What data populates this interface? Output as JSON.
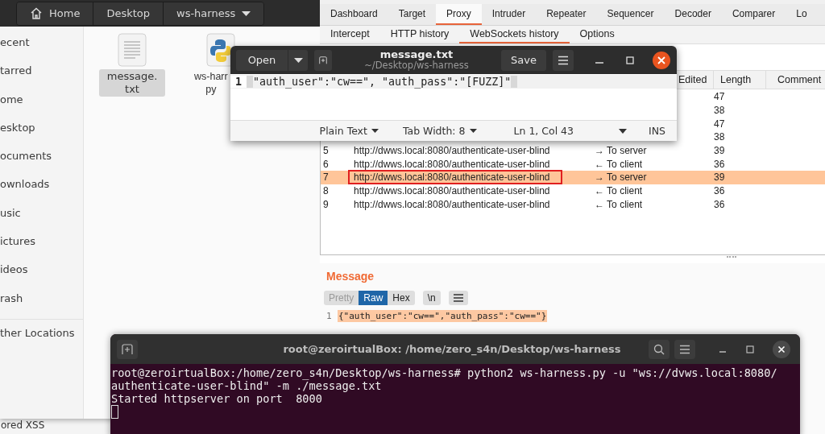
{
  "background_window": {
    "text": "ored XSS"
  },
  "file_manager": {
    "path": [
      {
        "label": "Home",
        "kind": "home"
      },
      {
        "label": "Desktop",
        "kind": "plain"
      },
      {
        "label": "ws-harness",
        "kind": "dropdown"
      }
    ],
    "sidebar": [
      "ecent",
      "tarred",
      "ome",
      "esktop",
      "ocuments",
      "ownloads",
      "usic",
      "ictures",
      "ideos",
      "rash"
    ],
    "sidebar_other": "ther Locations",
    "files": [
      {
        "kind": "text",
        "lines": [
          "message.",
          "txt"
        ],
        "selected": true
      },
      {
        "kind": "python",
        "lines": [
          "ws-harr",
          "py"
        ],
        "selected": false
      }
    ]
  },
  "burp": {
    "tabs": [
      {
        "label": "Dashboard",
        "selected": false
      },
      {
        "label": "Target",
        "selected": false
      },
      {
        "label": "Proxy",
        "selected": true
      },
      {
        "label": "Intruder",
        "selected": false
      },
      {
        "label": "Repeater",
        "selected": false
      },
      {
        "label": "Sequencer",
        "selected": false
      },
      {
        "label": "Decoder",
        "selected": false
      },
      {
        "label": "Comparer",
        "selected": false
      },
      {
        "label": "Lo",
        "selected": false
      }
    ],
    "subtabs": [
      {
        "label": "Intercept",
        "selected": false
      },
      {
        "label": "HTTP history",
        "selected": false
      },
      {
        "label": "WebSockets history",
        "selected": true
      },
      {
        "label": "Options",
        "selected": false
      }
    ],
    "columns": [
      "Edited",
      "Length",
      "Comment"
    ],
    "rows": [
      {
        "length": "47",
        "selected": false
      },
      {
        "length": "38",
        "selected": false
      },
      {
        "length": "47",
        "selected": false
      },
      {
        "length": "38",
        "selected": false
      },
      {
        "num": "5",
        "url": "http://dwws.local:8080/authenticate-user-blind",
        "direction": "→ To server",
        "length": "39",
        "selected": false,
        "annotated": false
      },
      {
        "num": "6",
        "url": "http://dwws.local:8080/authenticate-user-blind",
        "direction": "← To client",
        "length": "36",
        "selected": false,
        "annotated": false
      },
      {
        "num": "7",
        "url": "http://dwws.local:8080/authenticate-user-blind",
        "direction": "→ To server",
        "length": "39",
        "selected": true,
        "annotated": true
      },
      {
        "num": "8",
        "url": "http://dwws.local:8080/authenticate-user-blind",
        "direction": "← To client",
        "length": "36",
        "selected": false,
        "annotated": false
      },
      {
        "num": "9",
        "url": "http://dwws.local:8080/authenticate-user-blind",
        "direction": "← To client",
        "length": "36",
        "selected": false,
        "annotated": false
      }
    ],
    "message": {
      "title": "Message",
      "view_buttons": [
        {
          "label": "Pretty",
          "selected": false,
          "disabled": true
        },
        {
          "label": "Raw",
          "selected": true,
          "disabled": false
        },
        {
          "label": "Hex",
          "selected": false,
          "disabled": false
        }
      ],
      "newline_button": "\\n",
      "line_number": "1",
      "content": "{\"auth_user\":\"cw==\",\"auth_pass\":\"cw==\"}"
    }
  },
  "editor": {
    "open_label": "Open",
    "title": "message.txt",
    "subtitle": "~/Desktop/ws-harness",
    "save_label": "Save",
    "line_number": "1",
    "text": "\"auth_user\":\"cw==\", \"auth_pass\":\"[FUZZ]\"",
    "status": {
      "language": "Plain Text",
      "tab_width": "Tab Width: 8",
      "position": "Ln 1, Col 43",
      "mode": "INS"
    }
  },
  "terminal": {
    "title": "root@zeroirtualBox: /home/zero_s4n/Desktop/ws-harness",
    "lines": [
      "root@zeroirtualBox:/home/zero_s4n/Desktop/ws-harness# python2 ws-harness.py -u \"ws://dvws.local:8080/",
      "authenticate-user-blind\" -m ./message.txt",
      "Started httpserver on port  8000"
    ]
  }
}
